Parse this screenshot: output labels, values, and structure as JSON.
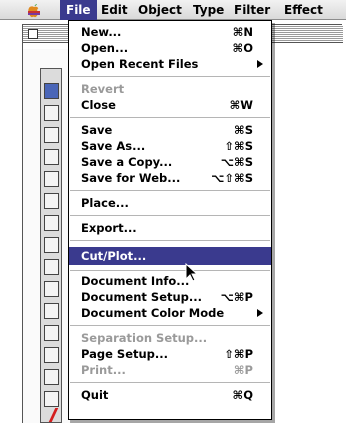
{
  "menubar": {
    "items": [
      {
        "label": "File",
        "active": true
      },
      {
        "label": "Edit",
        "active": false
      },
      {
        "label": "Object",
        "active": false
      },
      {
        "label": "Type",
        "active": false
      },
      {
        "label": "Filter",
        "active": false
      },
      {
        "label": "Effect",
        "active": false
      }
    ]
  },
  "file_menu": {
    "items": [
      {
        "label": "New...",
        "shortcut": "⌘N",
        "state": "enabled"
      },
      {
        "label": "Open...",
        "shortcut": "⌘O",
        "state": "enabled"
      },
      {
        "label": "Open Recent Files",
        "shortcut": "",
        "submenu": true,
        "state": "enabled"
      },
      {
        "label": "Revert",
        "shortcut": "",
        "state": "disabled"
      },
      {
        "label": "Close",
        "shortcut": "⌘W",
        "state": "enabled"
      },
      {
        "label": "Save",
        "shortcut": "⌘S",
        "state": "enabled"
      },
      {
        "label": "Save As...",
        "shortcut": "⇧⌘S",
        "state": "enabled"
      },
      {
        "label": "Save a Copy...",
        "shortcut": "⌥⌘S",
        "state": "enabled"
      },
      {
        "label": "Save for Web...",
        "shortcut": "⌥⇧⌘S",
        "state": "enabled"
      },
      {
        "label": "Place...",
        "shortcut": "",
        "state": "enabled"
      },
      {
        "label": "Export...",
        "shortcut": "",
        "state": "enabled"
      },
      {
        "label": "Cut/Plot...",
        "shortcut": "",
        "state": "selected"
      },
      {
        "label": "Document Info...",
        "shortcut": "",
        "state": "enabled"
      },
      {
        "label": "Document Setup...",
        "shortcut": "⌥⌘P",
        "state": "enabled"
      },
      {
        "label": "Document Color Mode",
        "shortcut": "",
        "submenu": true,
        "state": "enabled"
      },
      {
        "label": "Separation Setup...",
        "shortcut": "",
        "state": "disabled"
      },
      {
        "label": "Page Setup...",
        "shortcut": "⇧⌘P",
        "state": "enabled"
      },
      {
        "label": "Print...",
        "shortcut": "⌘P",
        "state": "disabled"
      },
      {
        "label": "Quit",
        "shortcut": "⌘Q",
        "state": "enabled"
      }
    ]
  },
  "colors": {
    "highlight": "#3a3a8e",
    "disabled_text": "#9a9a9a",
    "menu_bg": "#ffffff"
  }
}
